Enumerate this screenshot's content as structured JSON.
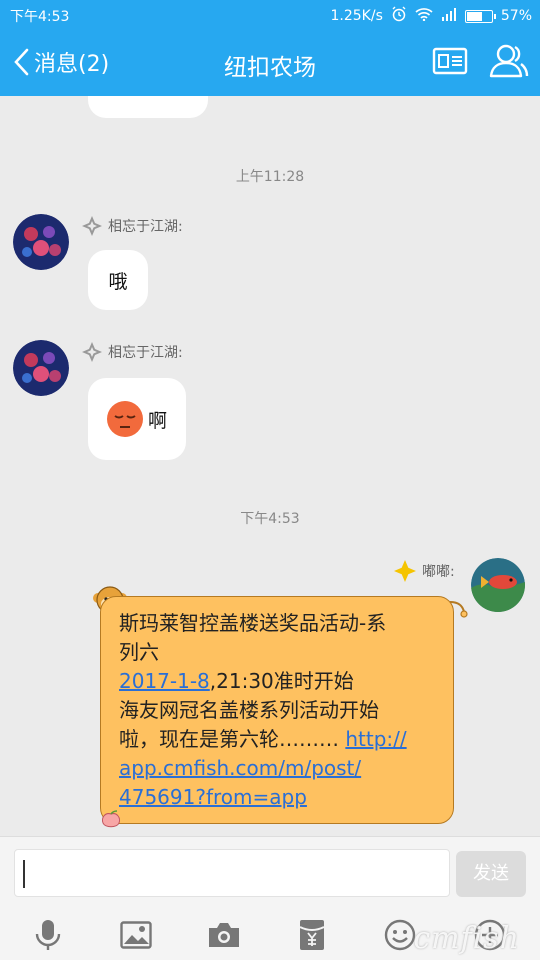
{
  "status": {
    "time": "下午4:53",
    "network_speed": "1.25K/s",
    "battery": "57%"
  },
  "header": {
    "back_label": "消息(2)",
    "title": "纽扣农场"
  },
  "messages": {
    "ts1": "上午11:28",
    "sender1": "相忘于江湖:",
    "text1": "哦",
    "sender2": "相忘于江湖:",
    "text2": "啊",
    "ts2": "下午4:53",
    "sender3": "嘟嘟:",
    "post_line1": "斯玛莱智控盖楼送奖品活动-系",
    "post_line2": "列六",
    "post_date_link": "2017-1-8",
    "post_date_rest": ",21:30准时开始",
    "post_line4": "海友网冠名盖楼系列活动开始",
    "post_line5_text": "啦，现在是第六轮……… ",
    "post_link_part1": "http://",
    "post_link_part2": "app.cmfish.com/m/post/",
    "post_link_part3": "475691?from=app"
  },
  "input": {
    "send_label": "发送"
  },
  "watermark": "cmfish"
}
